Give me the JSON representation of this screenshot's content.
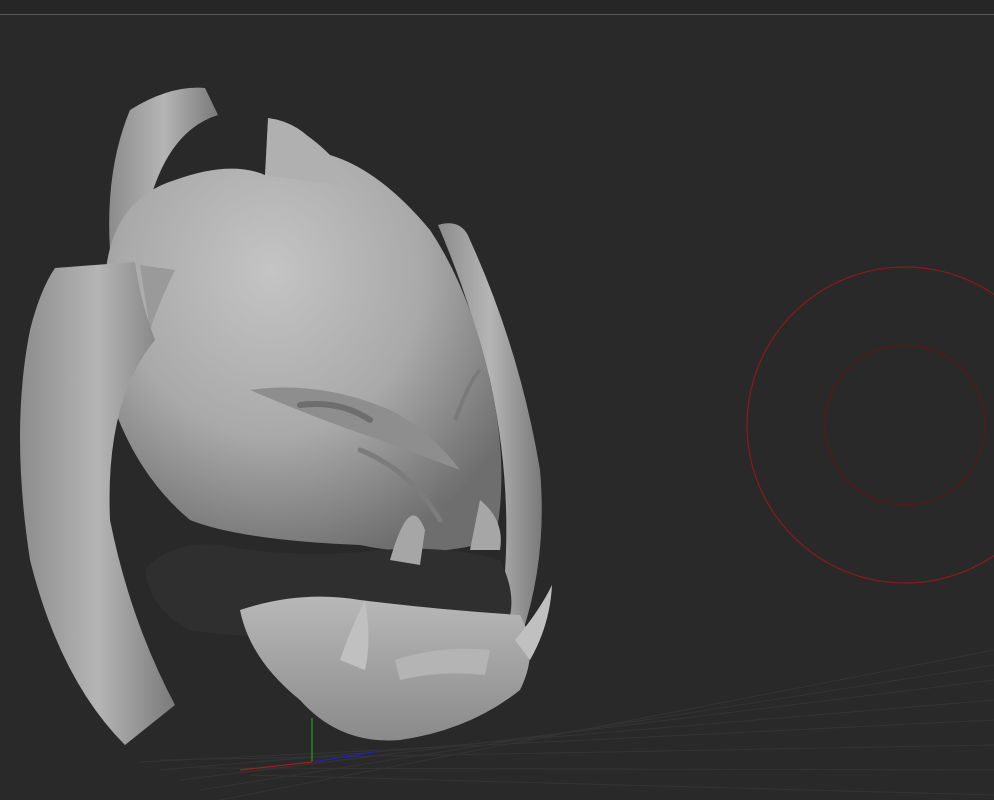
{
  "viewport": {
    "background": "#292929",
    "top_edge_line": "#5a5a5a"
  },
  "model": {
    "name": "sculpted-creature-head-icon",
    "material_color": "#a8a8a8"
  },
  "brush_cursor": {
    "icon": "brush-radius-circle-icon",
    "color": "#8a1a1a"
  },
  "axis_gizmo": {
    "icon": "axis-gizmo-icon",
    "x_color": "#a02020",
    "y_color": "#20a020",
    "z_color": "#2020c0"
  }
}
